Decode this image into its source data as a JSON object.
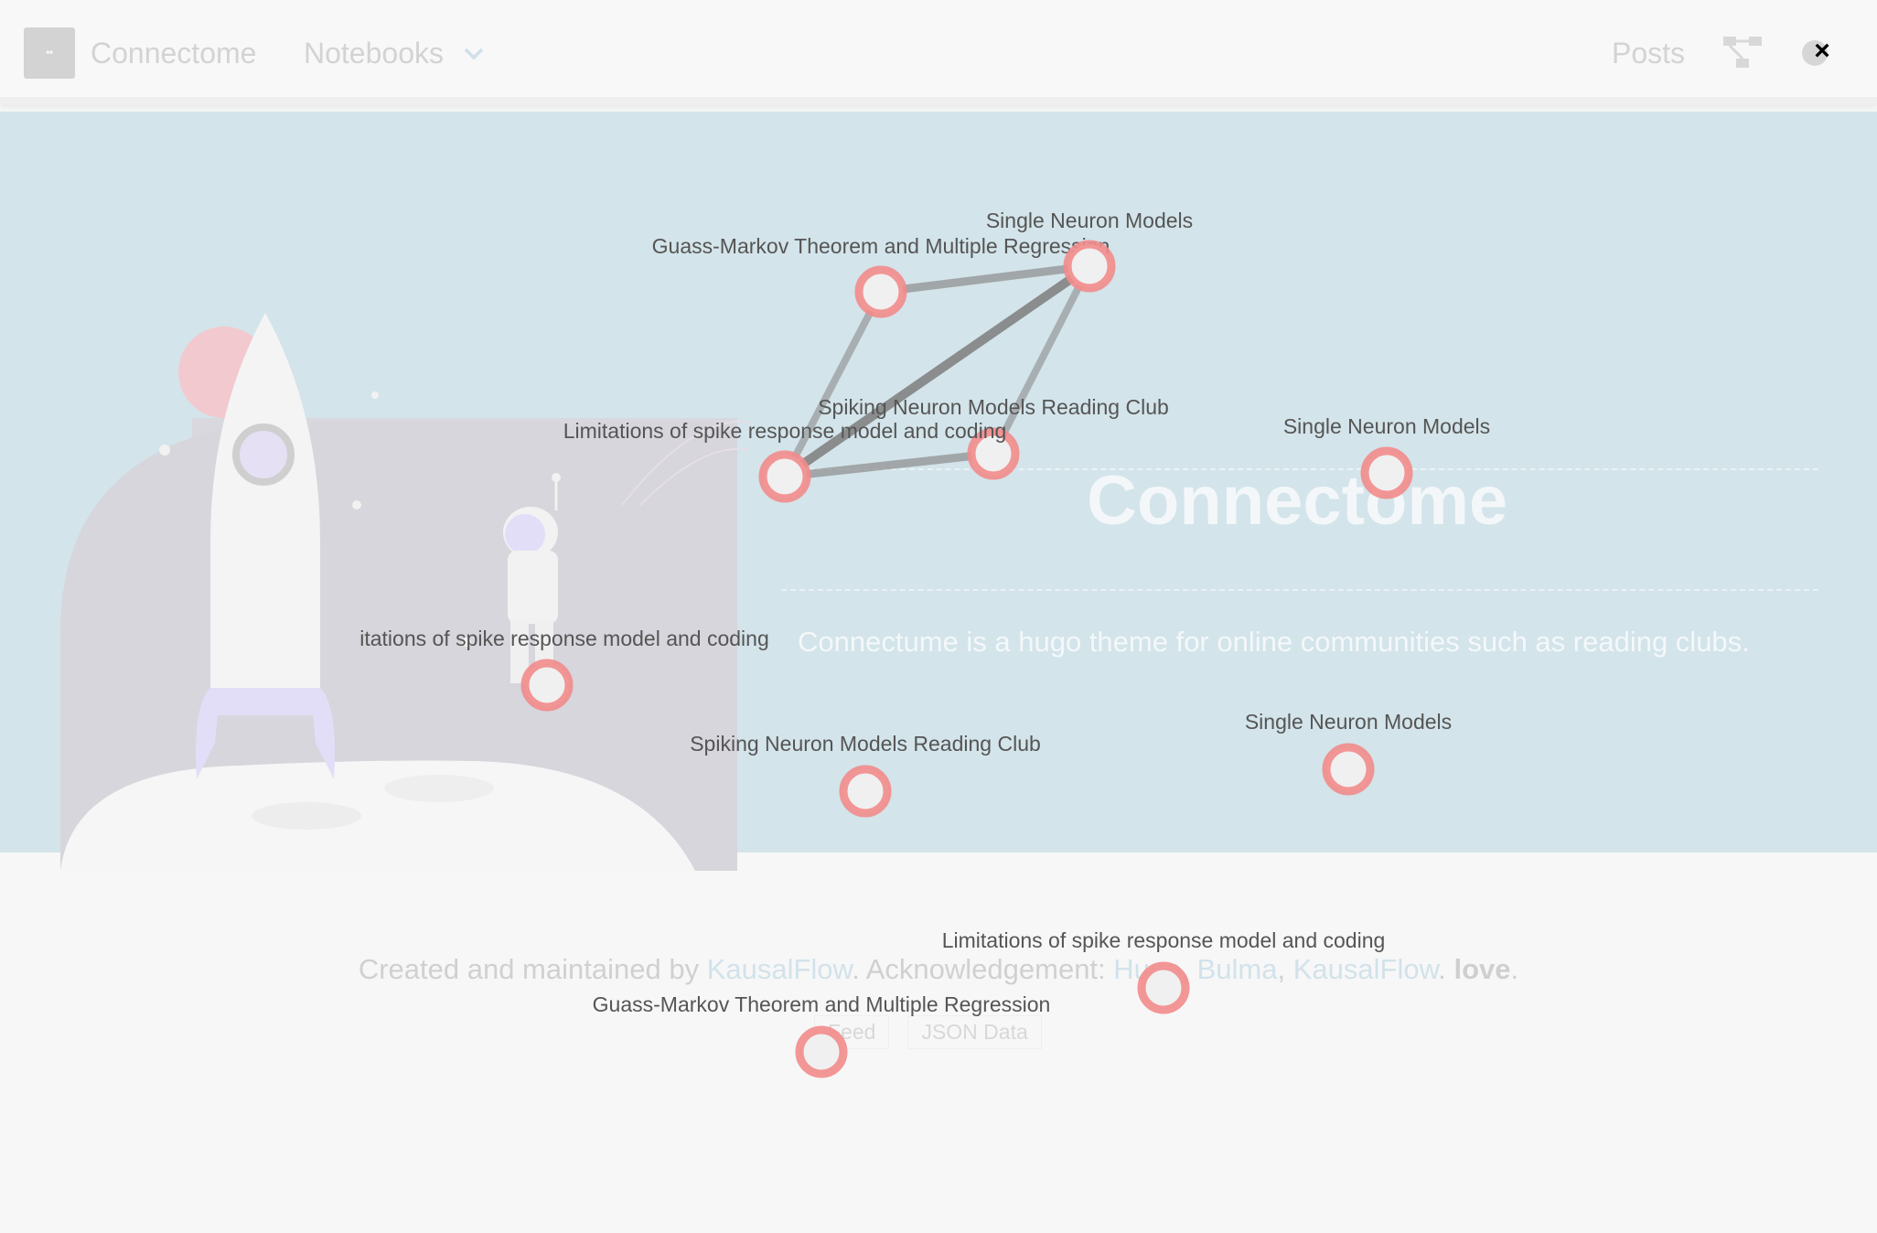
{
  "navbar": {
    "brand": "Connectome",
    "notebooks_label": "Notebooks",
    "posts_label": "Posts",
    "close_label": "×"
  },
  "hero": {
    "title": "Connectome",
    "subtitle": "Connectume is a hugo theme for online communities such as reading clubs."
  },
  "footer": {
    "created_prefix": "Created and maintained by ",
    "created_link": "KausalFlow",
    "ack_prefix": ". Acknowledgement: ",
    "ack_link1": "Hugo",
    "sep1": ", ",
    "ack_link2": "Bulma",
    "sep2": ", ",
    "ack_link3": "KausalFlow",
    "sep3": ". ",
    "love": "love",
    "end": ".",
    "feed_label": "Feed",
    "json_label": "JSON Data"
  },
  "graph": {
    "node_color": "#f28b8b",
    "edge_color": "#8c8c8c",
    "nodes": [
      {
        "label": "Guass-Markov Theorem and Multiple Regression"
      },
      {
        "label": "Single Neuron Models"
      },
      {
        "label": "Spiking Neuron Models Reading Club"
      },
      {
        "label": "Limitations of spike response model and coding"
      },
      {
        "label": "Single Neuron Models"
      },
      {
        "label": "itations of spike response model and coding"
      },
      {
        "label": "Spiking Neuron Models Reading Club"
      },
      {
        "label": "Single Neuron Models"
      },
      {
        "label": "Limitations of spike response model and coding"
      },
      {
        "label": "Guass-Markov Theorem and Multiple Regression"
      }
    ]
  }
}
